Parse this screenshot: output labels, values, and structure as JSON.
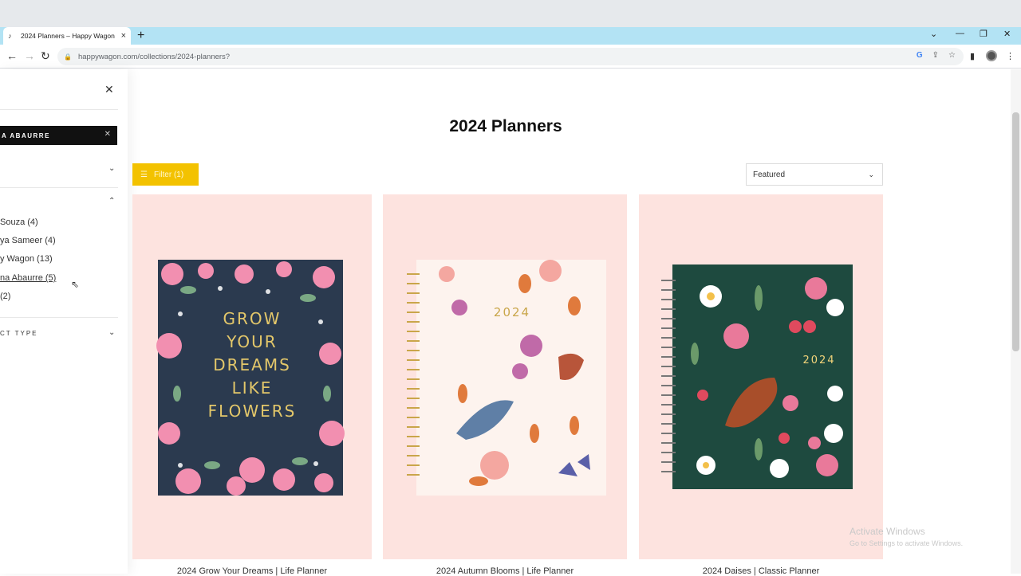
{
  "browser": {
    "tab_title": "2024 Planners – Happy Wagon",
    "url": "happywagon.com/collections/2024-planners?"
  },
  "drawer": {
    "active_filter": "A ABAURRE",
    "vendors": [
      {
        "label": "Souza (4)"
      },
      {
        "label": "ya Sameer (4)"
      },
      {
        "label": "y Wagon (13)"
      },
      {
        "label": "na Abaurre (5)"
      },
      {
        "label": "(2)"
      }
    ],
    "product_type_label": "CT TYPE"
  },
  "main": {
    "title": "2024 Planners",
    "filter_label": "Filter (1)",
    "sort_value": "Featured"
  },
  "products": [
    {
      "name": "2024 Grow Your Dreams | Life Planner",
      "cover_text": [
        "GROW",
        "YOUR",
        "DREAMS",
        "LIKE",
        "FLOWERS"
      ],
      "bg": "#fde3df"
    },
    {
      "name": "2024 Autumn Blooms | Life Planner",
      "cover_year": "2024",
      "bg": "#fde3df"
    },
    {
      "name": "2024 Daises | Classic Planner",
      "cover_year": "2024",
      "bg": "#fde3df"
    }
  ],
  "watermark": {
    "line1": "Activate Windows",
    "line2": "Go to Settings to activate Windows."
  },
  "colors": {
    "accent_yellow": "#f3c200",
    "card_pink": "#fde3df",
    "cover1_navy": "#2b3a4f",
    "cover3_green": "#1e4a3f"
  }
}
